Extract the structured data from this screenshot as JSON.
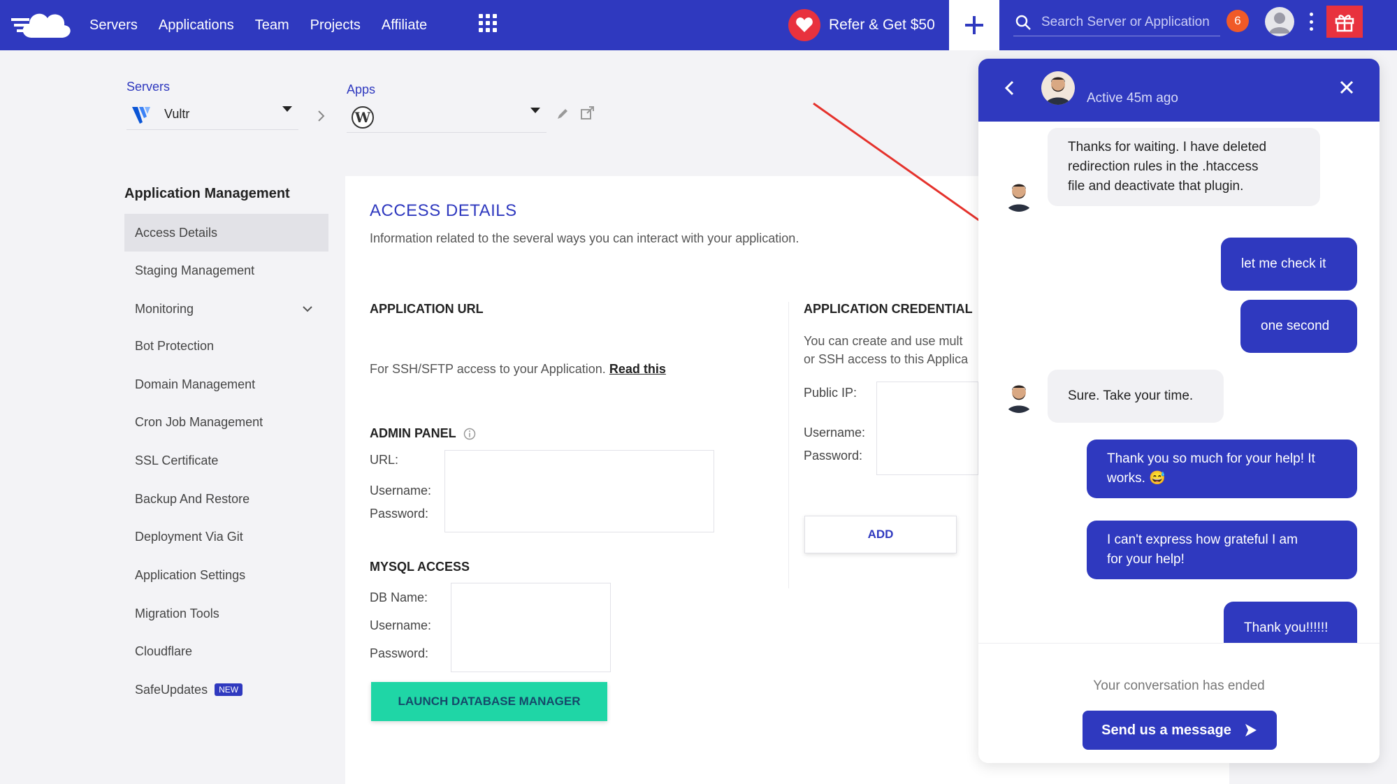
{
  "nav": {
    "links": [
      "Servers",
      "Applications",
      "Team",
      "Projects",
      "Affiliate"
    ],
    "refer_label": "Refer & Get $50",
    "search_placeholder": "Search Server or Application",
    "notification_count": "6",
    "colors": {
      "brand": "#2f39bf",
      "accent_red": "#e8323e",
      "badge": "#f05a28"
    }
  },
  "selectors": {
    "servers_label": "Servers",
    "server_value": "Vultr",
    "apps_label": "Apps"
  },
  "sidebar": {
    "heading": "Application Management",
    "items": [
      "Access Details",
      "Staging Management",
      "Monitoring",
      "Bot Protection",
      "Domain Management",
      "Cron Job Management",
      "SSL Certificate",
      "Backup And Restore",
      "Deployment Via Git",
      "Application Settings",
      "Migration Tools",
      "Cloudflare",
      "SafeUpdates"
    ],
    "new_badge": "NEW",
    "active_item": "Access Details"
  },
  "main": {
    "title": "ACCESS DETAILS",
    "subtitle": "Information related to the several ways you can interact with your application.",
    "app_url": {
      "title": "APPLICATION URL",
      "text": "For SSH/SFTP access to your Application.",
      "link": "Read this"
    },
    "admin_panel": {
      "title": "ADMIN PANEL",
      "url_label": "URL:",
      "username_label": "Username:",
      "password_label": "Password:"
    },
    "mysql": {
      "title": "MYSQL ACCESS",
      "db_label": "DB Name:",
      "username_label": "Username:",
      "password_label": "Password:",
      "button": "LAUNCH DATABASE MANAGER"
    },
    "credentials": {
      "title": "APPLICATION CREDENTIAL",
      "line1": "You can create and use mult",
      "line2": "or SSH access to this Applica",
      "public_ip_label": "Public IP:",
      "username_label": "Username:",
      "password_label": "Password:",
      "add_button": "ADD"
    }
  },
  "chat": {
    "status": "Active 45m ago",
    "messages": [
      {
        "from": "agent",
        "lines": [
          "Thanks for waiting. I have deleted",
          "redirection rules in the .htaccess",
          "file and deactivate that plugin."
        ]
      },
      {
        "from": "user",
        "lines": [
          "let me check it"
        ]
      },
      {
        "from": "user",
        "lines": [
          "one second"
        ]
      },
      {
        "from": "agent",
        "lines": [
          "Sure. Take your time."
        ]
      },
      {
        "from": "user",
        "lines": [
          "Thank you so much for your help! It",
          "works. 😅"
        ]
      },
      {
        "from": "user",
        "lines": [
          "I can't express how grateful I am",
          "for your help!"
        ]
      },
      {
        "from": "user",
        "lines": [
          "Thank you!!!!!!"
        ]
      }
    ],
    "ended_text": "Your conversation has ended",
    "send_button": "Send us a message"
  }
}
